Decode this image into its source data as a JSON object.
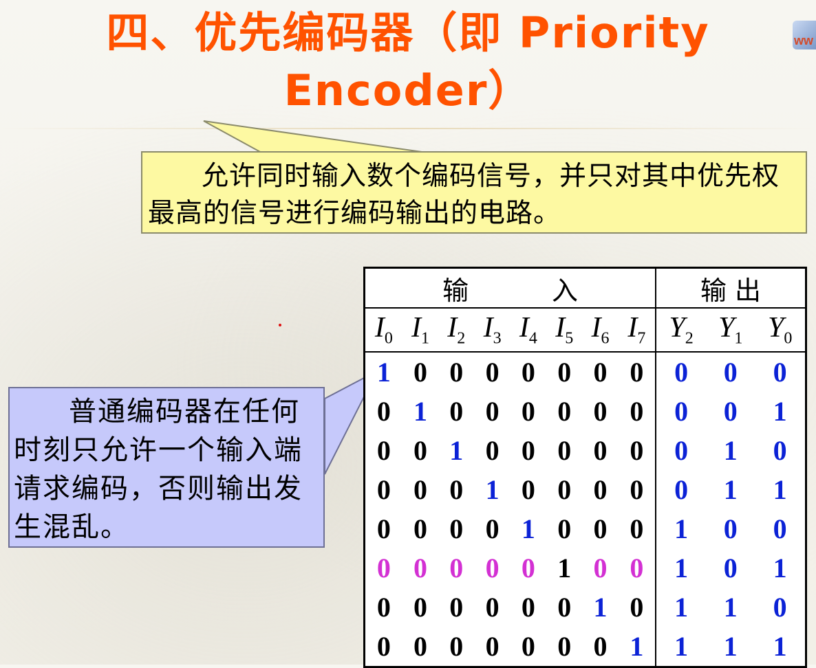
{
  "slide": {
    "title_line1": "四、优先编码器（即 Priority",
    "title_line2": "Encoder）",
    "logo_text": "ww"
  },
  "callout_priority": {
    "text": "允许同时输入数个编码信号，并只对其中优先权最高的信号进行编码输出的电路。"
  },
  "callout_ordinary": {
    "text": "普通编码器在任何时刻只允许一个输入端请求编码，否则输出发生混乱。"
  },
  "truth_table": {
    "inputs_header": "输          入",
    "outputs_header": "输 出",
    "input_vars": [
      {
        "base": "I",
        "sub": "0"
      },
      {
        "base": "I",
        "sub": "1"
      },
      {
        "base": "I",
        "sub": "2"
      },
      {
        "base": "I",
        "sub": "3"
      },
      {
        "base": "I",
        "sub": "4"
      },
      {
        "base": "I",
        "sub": "5"
      },
      {
        "base": "I",
        "sub": "6"
      },
      {
        "base": "I",
        "sub": "7"
      }
    ],
    "output_vars": [
      {
        "base": "Y",
        "sub": "2"
      },
      {
        "base": "Y",
        "sub": "1"
      },
      {
        "base": "Y",
        "sub": "0"
      }
    ],
    "rows": [
      {
        "inputs": [
          "1",
          "0",
          "0",
          "0",
          "0",
          "0",
          "0",
          "0"
        ],
        "outputs": [
          "0",
          "0",
          "0"
        ],
        "input_colors": [
          "blue",
          "black",
          "black",
          "black",
          "black",
          "black",
          "black",
          "black"
        ]
      },
      {
        "inputs": [
          "0",
          "1",
          "0",
          "0",
          "0",
          "0",
          "0",
          "0"
        ],
        "outputs": [
          "0",
          "0",
          "1"
        ],
        "input_colors": [
          "black",
          "blue",
          "black",
          "black",
          "black",
          "black",
          "black",
          "black"
        ]
      },
      {
        "inputs": [
          "0",
          "0",
          "1",
          "0",
          "0",
          "0",
          "0",
          "0"
        ],
        "outputs": [
          "0",
          "1",
          "0"
        ],
        "input_colors": [
          "black",
          "black",
          "blue",
          "black",
          "black",
          "black",
          "black",
          "black"
        ]
      },
      {
        "inputs": [
          "0",
          "0",
          "0",
          "1",
          "0",
          "0",
          "0",
          "0"
        ],
        "outputs": [
          "0",
          "1",
          "1"
        ],
        "input_colors": [
          "black",
          "black",
          "black",
          "blue",
          "black",
          "black",
          "black",
          "black"
        ]
      },
      {
        "inputs": [
          "0",
          "0",
          "0",
          "0",
          "1",
          "0",
          "0",
          "0"
        ],
        "outputs": [
          "1",
          "0",
          "0"
        ],
        "input_colors": [
          "black",
          "black",
          "black",
          "black",
          "blue",
          "black",
          "black",
          "black"
        ]
      },
      {
        "inputs": [
          "0",
          "0",
          "0",
          "0",
          "0",
          "1",
          "0",
          "0"
        ],
        "outputs": [
          "1",
          "0",
          "1"
        ],
        "input_colors": [
          "magenta",
          "magenta",
          "magenta",
          "magenta",
          "magenta",
          "black",
          "magenta",
          "magenta"
        ]
      },
      {
        "inputs": [
          "0",
          "0",
          "0",
          "0",
          "0",
          "0",
          "1",
          "0"
        ],
        "outputs": [
          "1",
          "1",
          "0"
        ],
        "input_colors": [
          "black",
          "black",
          "black",
          "black",
          "black",
          "black",
          "blue",
          "black"
        ]
      },
      {
        "inputs": [
          "0",
          "0",
          "0",
          "0",
          "0",
          "0",
          "0",
          "1"
        ],
        "outputs": [
          "1",
          "1",
          "1"
        ],
        "input_colors": [
          "black",
          "black",
          "black",
          "black",
          "black",
          "black",
          "black",
          "blue"
        ]
      }
    ],
    "colors": {
      "blue": "#0b22d6",
      "black": "#000000",
      "magenta": "#d330d3"
    }
  }
}
